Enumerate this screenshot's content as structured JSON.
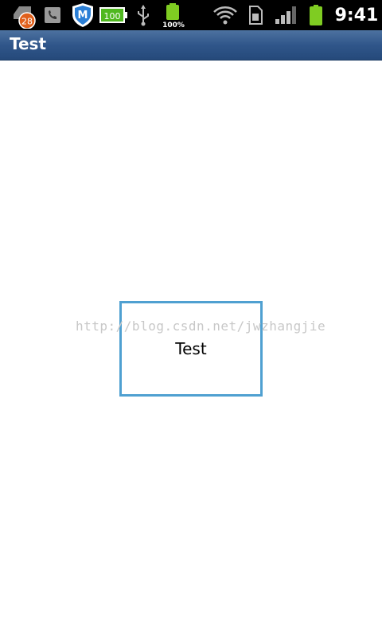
{
  "status_bar": {
    "notification_count": "28",
    "battery_app_label": "100",
    "battery_percent_label": "100%",
    "time": "9:41",
    "icons": [
      "notification-badge-icon",
      "phone-app-icon",
      "security-shield-icon",
      "battery-widget-icon",
      "usb-icon",
      "battery-level-icon",
      "wifi-icon",
      "sim-card-icon",
      "signal-strength-icon",
      "battery-icon"
    ],
    "colors": {
      "background": "#000000",
      "battery_green": "#7fcc22",
      "badge_orange": "#e0601c",
      "shield_blue": "#2b7fd6"
    }
  },
  "app_bar": {
    "title": "Test",
    "colors": {
      "top": "#4d72a0",
      "bottom": "#25497a"
    }
  },
  "main": {
    "button_label": "Test",
    "border_color": "#4fa0d1",
    "watermark": "http://blog.csdn.net/jwzhangjie"
  }
}
